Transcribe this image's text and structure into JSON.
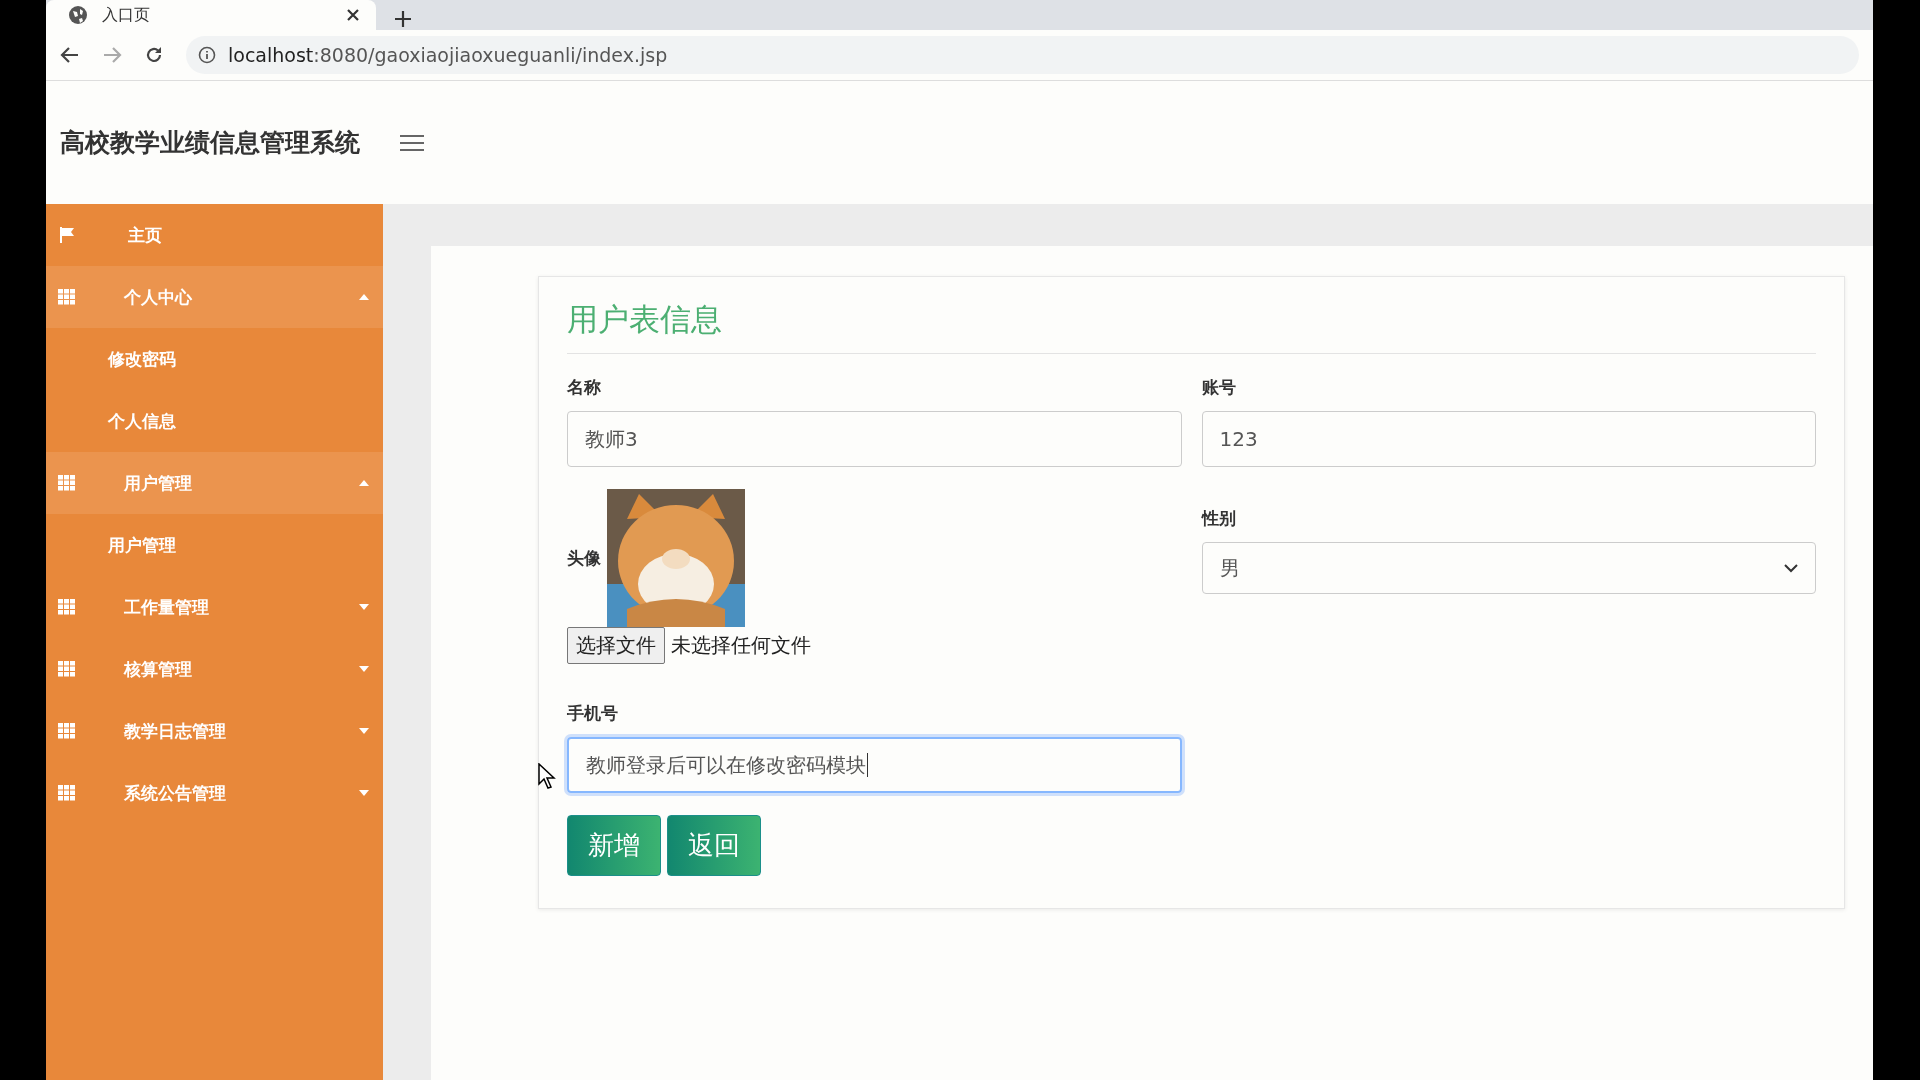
{
  "browser": {
    "tab_title": "入口页",
    "url_host": "localhost",
    "url_rest": ":8080/gaoxiaojiaoxueguanli/index.jsp"
  },
  "header": {
    "title": "高校教学业绩信息管理系统"
  },
  "sidebar": {
    "items": [
      {
        "kind": "link",
        "label": "主页"
      },
      {
        "kind": "menu",
        "label": "个人中心",
        "expanded": true,
        "children": [
          {
            "label": "修改密码"
          },
          {
            "label": "个人信息"
          }
        ]
      },
      {
        "kind": "menu",
        "label": "用户管理",
        "expanded": true,
        "children": [
          {
            "label": "用户管理"
          }
        ]
      },
      {
        "kind": "menu",
        "label": "工作量管理",
        "expanded": false
      },
      {
        "kind": "menu",
        "label": "核算管理",
        "expanded": false
      },
      {
        "kind": "menu",
        "label": "教学日志管理",
        "expanded": false
      },
      {
        "kind": "menu",
        "label": "系统公告管理",
        "expanded": false
      }
    ]
  },
  "form": {
    "title": "用户表信息",
    "name": {
      "label": "名称",
      "value": "教师3"
    },
    "account": {
      "label": "账号",
      "value": "123"
    },
    "avatar": {
      "label": "头像",
      "file_button": "选择文件",
      "file_status": "未选择任何文件"
    },
    "gender": {
      "label": "性别",
      "value": "男"
    },
    "phone": {
      "label": "手机号",
      "value": "教师登录后可以在修改密码模块",
      "focused": true
    },
    "buttons": [
      {
        "label": "新增"
      },
      {
        "label": "返回"
      }
    ]
  }
}
